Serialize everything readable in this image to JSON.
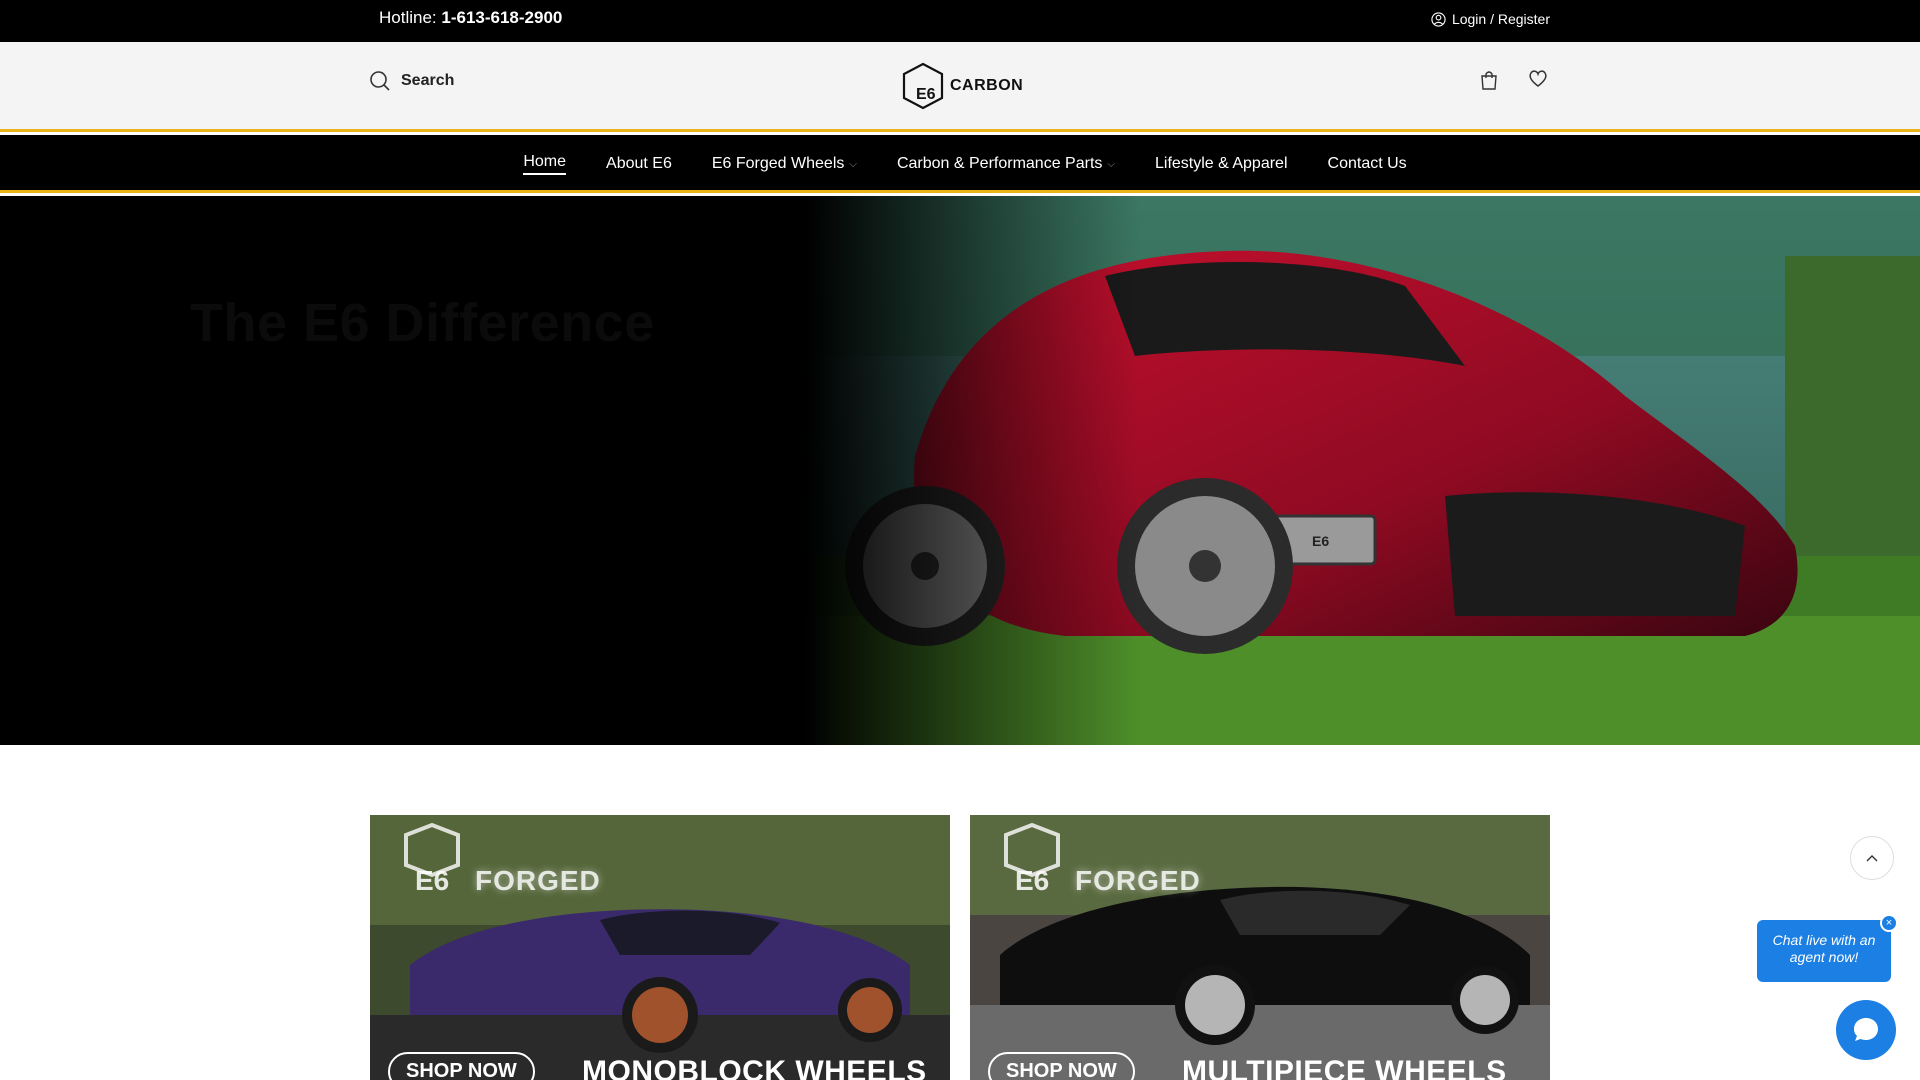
{
  "topbar": {
    "hotline_label": "Hotline:",
    "hotline_number": "1-613-618-2900",
    "login_label": "Login / Register"
  },
  "header": {
    "search_label": "Search",
    "logo_mark": "E6",
    "logo_text": "CARBON",
    "cart_icon": "cart-icon",
    "wishlist_icon": "heart-icon"
  },
  "nav": {
    "items": [
      {
        "label": "Home",
        "active": true,
        "dropdown": false
      },
      {
        "label": "About E6",
        "active": false,
        "dropdown": false
      },
      {
        "label": "E6 Forged Wheels",
        "active": false,
        "dropdown": true
      },
      {
        "label": "Carbon & Performance Parts",
        "active": false,
        "dropdown": true
      },
      {
        "label": "Lifestyle & Apparel",
        "active": false,
        "dropdown": false
      },
      {
        "label": "Contact Us",
        "active": false,
        "dropdown": false
      }
    ]
  },
  "hero": {
    "title": "The E6 Difference",
    "plate_text": "E6"
  },
  "cards": [
    {
      "mark": "E6",
      "brand": "FORGED",
      "cta": "SHOP NOW",
      "title": "MONOBLOCK WHEELS"
    },
    {
      "mark": "E6",
      "brand": "FORGED",
      "cta": "SHOP NOW",
      "title": "MULTIPIECE WHEELS"
    }
  ],
  "chat": {
    "bubble_text": "Chat live with an agent now!",
    "close_glyph": "×"
  },
  "colors": {
    "accent": "#e8b417",
    "chat_blue": "#1b7fe3",
    "bar_black": "#000000"
  }
}
